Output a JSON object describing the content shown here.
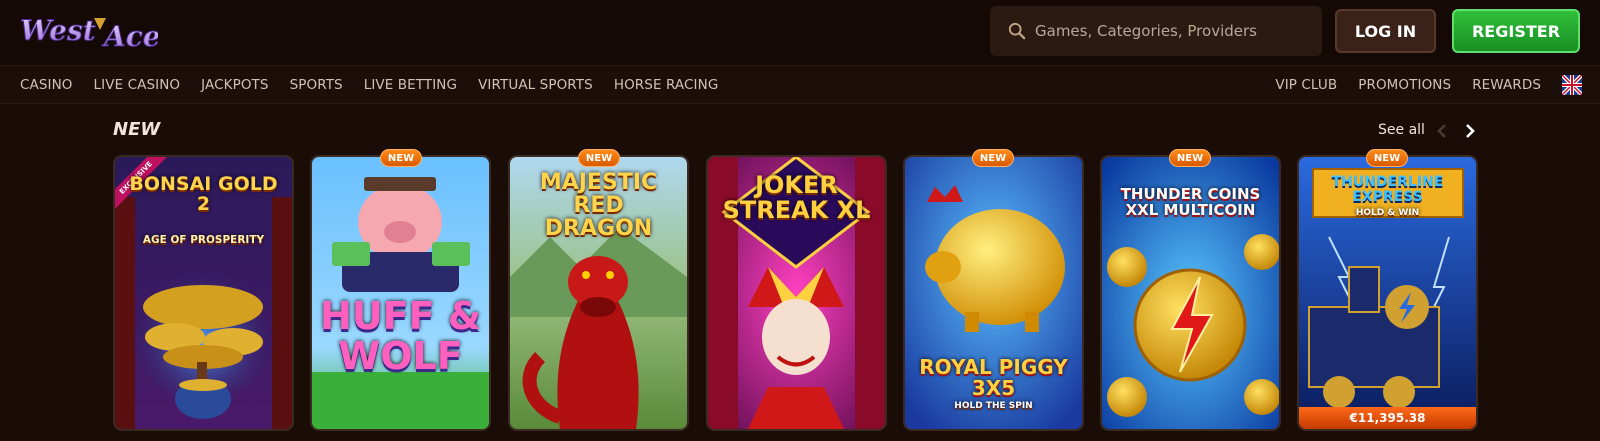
{
  "brand": {
    "name": "West Ace"
  },
  "search": {
    "placeholder": "Games, Categories, Providers"
  },
  "auth": {
    "login_label": "LOG IN",
    "register_label": "REGISTER"
  },
  "nav": {
    "left": [
      "CASINO",
      "LIVE CASINO",
      "JACKPOTS",
      "SPORTS",
      "LIVE BETTING",
      "VIRTUAL SPORTS",
      "HORSE RACING"
    ],
    "right": [
      "VIP CLUB",
      "PROMOTIONS",
      "REWARDS"
    ],
    "language_icon": "uk-flag-icon"
  },
  "section": {
    "title": "NEW",
    "see_all": "See all"
  },
  "games": [
    {
      "title": "BONSAI GOLD 2",
      "subtitle": "AGE OF PROSPERITY",
      "badge": "",
      "ribbon": "EXCLUSIVE",
      "jackpot": ""
    },
    {
      "title": "HUFF & WOLF",
      "subtitle": "",
      "badge": "NEW",
      "ribbon": "",
      "jackpot": ""
    },
    {
      "title": "MAJESTIC RED DRAGON",
      "subtitle": "",
      "badge": "NEW",
      "ribbon": "",
      "jackpot": ""
    },
    {
      "title": "JOKER STREAK XL",
      "subtitle": "",
      "badge": "",
      "ribbon": "",
      "jackpot": ""
    },
    {
      "title": "ROYAL PIGGY 3X5",
      "subtitle": "HOLD THE SPIN",
      "badge": "NEW",
      "ribbon": "",
      "jackpot": ""
    },
    {
      "title": "THUNDER COINS XXL MULTICOIN",
      "subtitle": "",
      "badge": "NEW",
      "ribbon": "",
      "jackpot": ""
    },
    {
      "title": "THUNDERLINE EXPRESS",
      "subtitle": "HOLD & WIN",
      "badge": "NEW",
      "ribbon": "",
      "jackpot": "€11,395.38"
    }
  ],
  "colors": {
    "background": "#1a0d08",
    "register": "#2fbf3a",
    "badge": "#ff8a1a"
  }
}
